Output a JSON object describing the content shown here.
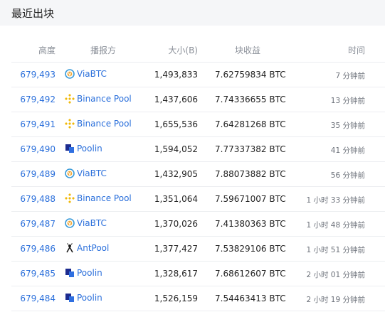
{
  "section_title": "最近出块",
  "columns": {
    "height": "高度",
    "miner": "播报方",
    "size": "大小(B)",
    "reward": "块收益",
    "time": "时间"
  },
  "rows": [
    {
      "height": "679,493",
      "miner": "ViaBTC",
      "icon": "viabtc-icon",
      "size": "1,493,833",
      "reward": "7.62759834 BTC",
      "time": "7 分钟前"
    },
    {
      "height": "679,492",
      "miner": "Binance Pool",
      "icon": "binance-pool-icon",
      "size": "1,437,606",
      "reward": "7.74336655 BTC",
      "time": "13 分钟前"
    },
    {
      "height": "679,491",
      "miner": "Binance Pool",
      "icon": "binance-pool-icon",
      "size": "1,655,536",
      "reward": "7.64281268 BTC",
      "time": "35 分钟前"
    },
    {
      "height": "679,490",
      "miner": "Poolin",
      "icon": "poolin-icon",
      "size": "1,594,052",
      "reward": "7.77337382 BTC",
      "time": "41 分钟前"
    },
    {
      "height": "679,489",
      "miner": "ViaBTC",
      "icon": "viabtc-icon",
      "size": "1,432,905",
      "reward": "7.88073882 BTC",
      "time": "56 分钟前"
    },
    {
      "height": "679,488",
      "miner": "Binance Pool",
      "icon": "binance-pool-icon",
      "size": "1,351,064",
      "reward": "7.59671007 BTC",
      "time": "1 小时 33 分钟前"
    },
    {
      "height": "679,487",
      "miner": "ViaBTC",
      "icon": "viabtc-icon",
      "size": "1,370,026",
      "reward": "7.41380363 BTC",
      "time": "1 小时 48 分钟前"
    },
    {
      "height": "679,486",
      "miner": "AntPool",
      "icon": "antpool-icon",
      "size": "1,377,427",
      "reward": "7.53829106 BTC",
      "time": "1 小时 51 分钟前"
    },
    {
      "height": "679,485",
      "miner": "Poolin",
      "icon": "poolin-icon",
      "size": "1,328,617",
      "reward": "7.68612607 BTC",
      "time": "2 小时 01 分钟前"
    },
    {
      "height": "679,484",
      "miner": "Poolin",
      "icon": "poolin-icon",
      "size": "1,526,159",
      "reward": "7.54463413 BTC",
      "time": "2 小时 19 分钟前"
    }
  ]
}
